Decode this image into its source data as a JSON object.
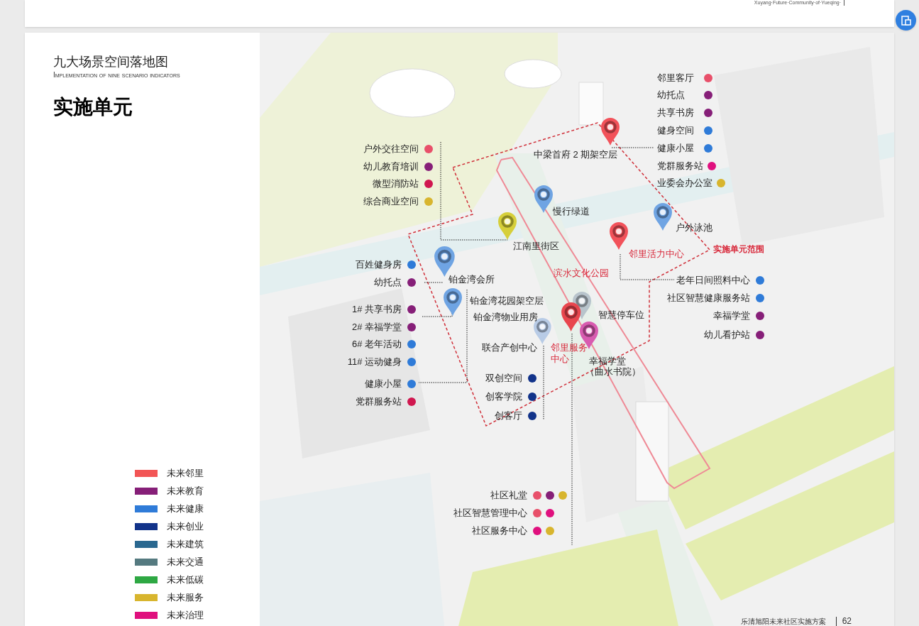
{
  "previous_page": {
    "footer_text": "Xuyang·Future·Community·of·Yueqing·"
  },
  "page": {
    "title": "九大场景空间落地图",
    "subtitle": "Implementation of nine scenario indicators",
    "heading": "实施单元",
    "legend": [
      {
        "label": "未来邻里",
        "color": "#f25555"
      },
      {
        "label": "未来教育",
        "color": "#861f78"
      },
      {
        "label": "未来健康",
        "color": "#2f7bd8"
      },
      {
        "label": "未来创业",
        "color": "#12338a"
      },
      {
        "label": "未来建筑",
        "color": "#2a6890"
      },
      {
        "label": "未来交通",
        "color": "#557a80"
      },
      {
        "label": "未来低碳",
        "color": "#2ea843"
      },
      {
        "label": "未来服务",
        "color": "#d8b52e"
      },
      {
        "label": "未来治理",
        "color": "#e0107e"
      }
    ],
    "map": {
      "point_lists": [
        {
          "items": [
            {
              "text": "邻里客厅",
              "dots": [
                {
                  "color": "#e8506a"
                }
              ]
            },
            {
              "text": "幼托点",
              "dots": [
                {
                  "color": "#861f78"
                }
              ]
            },
            {
              "text": "共享书房",
              "dots": [
                {
                  "color": "#861f78"
                }
              ]
            },
            {
              "text": "健身空间",
              "dots": [
                {
                  "color": "#2f7bd8"
                }
              ]
            },
            {
              "text": "健康小屋",
              "dots": [
                {
                  "color": "#2f7bd8"
                }
              ]
            },
            {
              "text": "党群服务站",
              "dots": [
                {
                  "color": "#e0107e"
                }
              ]
            },
            {
              "text": "业委会办公室",
              "dots": [
                {
                  "color": "#d8b52e"
                }
              ]
            }
          ]
        },
        {
          "items": [
            {
              "text": "户外交往空间",
              "dots": [
                {
                  "color": "#e8506a"
                }
              ]
            },
            {
              "text": "幼儿教育培训",
              "dots": [
                {
                  "color": "#861f78"
                }
              ]
            },
            {
              "text": "微型消防站",
              "dots": [
                {
                  "color": "#d0174f"
                }
              ]
            },
            {
              "text": "综合商业空间",
              "dots": [
                {
                  "color": "#d8b52e"
                }
              ]
            }
          ]
        },
        {
          "items": [
            {
              "text": "百姓健身房",
              "dots": [
                {
                  "color": "#2f7bd8"
                }
              ]
            },
            {
              "text": "幼托点",
              "dots": [
                {
                  "color": "#861f78"
                }
              ]
            },
            {
              "text": "1# 共享书房",
              "dots": [
                {
                  "color": "#861f78"
                }
              ]
            },
            {
              "text": "2# 幸福学堂",
              "dots": [
                {
                  "color": "#861f78"
                }
              ]
            },
            {
              "text": "6# 老年活动",
              "dots": [
                {
                  "color": "#2f7bd8"
                }
              ]
            },
            {
              "text": "11# 运动健身",
              "dots": [
                {
                  "color": "#2f7bd8"
                }
              ]
            },
            {
              "text": "健康小屋",
              "dots": [
                {
                  "color": "#2f7bd8"
                }
              ]
            },
            {
              "text": "党群服务站",
              "dots": [
                {
                  "color": "#d0174f"
                }
              ]
            }
          ]
        },
        {
          "items": [
            {
              "text": "双创空间",
              "dots": [
                {
                  "color": "#12338a"
                }
              ]
            },
            {
              "text": "创客学院",
              "dots": [
                {
                  "color": "#12338a"
                }
              ]
            },
            {
              "text": "创客厅",
              "dots": [
                {
                  "color": "#12338a"
                }
              ]
            }
          ]
        },
        {
          "items": [
            {
              "text": "老年日间照料中心",
              "dots": [
                {
                  "color": "#2f7bd8"
                }
              ]
            },
            {
              "text": "社区智慧健康服务站",
              "dots": [
                {
                  "color": "#2f7bd8"
                }
              ]
            },
            {
              "text": "幸福学堂",
              "dots": [
                {
                  "color": "#861f78"
                }
              ]
            },
            {
              "text": "幼儿看护站",
              "dots": [
                {
                  "color": "#861f78"
                }
              ]
            }
          ]
        },
        {
          "items": [
            {
              "text": "社区礼堂",
              "dots": [
                {
                  "color": "#e8506a"
                },
                {
                  "color": "#861f78"
                },
                {
                  "color": "#d8b52e"
                }
              ]
            },
            {
              "text": "社区智慧管理中心",
              "dots": [
                {
                  "color": "#e8506a"
                },
                {
                  "color": "#e0107e"
                }
              ]
            },
            {
              "text": "社区服务中心",
              "dots": [
                {
                  "color": "#e0107e"
                },
                {
                  "color": "#d8b52e"
                }
              ]
            }
          ]
        }
      ],
      "place_labels": [
        {
          "text": "中梁首府 2 期架空层",
          "emphasis": false
        },
        {
          "text": "慢行绿道",
          "emphasis": false
        },
        {
          "text": "户外泳池",
          "emphasis": false
        },
        {
          "text": "江南里街区",
          "emphasis": false
        },
        {
          "text": "邻里活力中心",
          "emphasis": true
        },
        {
          "text": "实施单元范围",
          "emphasis": true
        },
        {
          "text": "滨水文化公园",
          "emphasis": true
        },
        {
          "text": "铂金湾会所",
          "emphasis": false
        },
        {
          "text": "铂金湾花园架空层",
          "emphasis": false
        },
        {
          "text": "铂金湾物业用房",
          "emphasis": false
        },
        {
          "text": "智慧停车位",
          "emphasis": false
        },
        {
          "text": "联合产创中心",
          "emphasis": false
        },
        {
          "text": "邻里服务中心",
          "emphasis": true
        },
        {
          "text": "幸福学堂",
          "emphasis": false
        },
        {
          "text": "（曲水书院）",
          "emphasis": false
        }
      ],
      "pins": [
        {
          "color": "#f2525a"
        },
        {
          "color": "#6fa4e3"
        },
        {
          "color": "#d6cf3a"
        },
        {
          "color": "#f2525a"
        },
        {
          "color": "#6fa4e3"
        },
        {
          "color": "#6fa4e3"
        },
        {
          "color": "#6fa4e3"
        },
        {
          "color": "#b8c4cc"
        },
        {
          "color": "#e8464e"
        },
        {
          "color": "#b8cbe6"
        },
        {
          "color": "#d85bb0"
        }
      ]
    },
    "footer": {
      "title": "乐清旭阳未来社区实施方案",
      "page_number": "62"
    }
  }
}
